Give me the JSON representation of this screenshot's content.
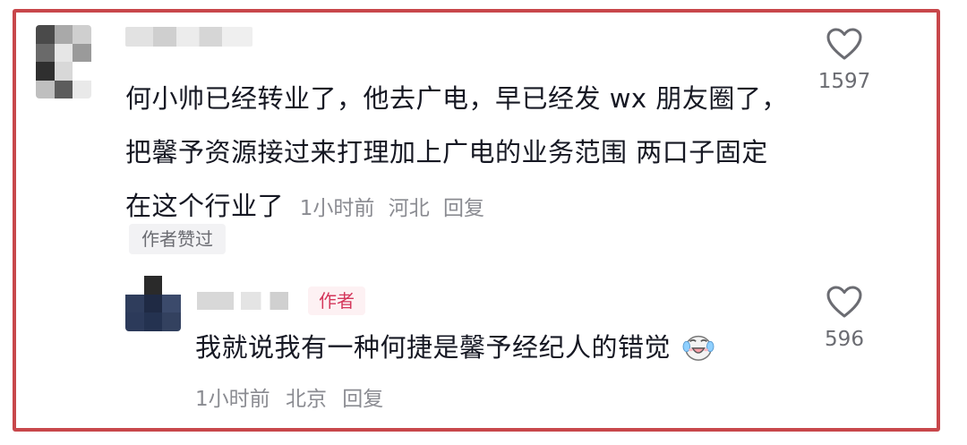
{
  "comment": {
    "avatar_colors": [
      "#4a4a4a",
      "#a9a9a9",
      "#cfcfcf",
      "#6a6a6a",
      "#e6e6e6",
      "#9a9a9a",
      "#2f2f2f",
      "#d8d8d8",
      "#ffffff",
      "#bfbfbf",
      "#5c5c5c",
      "#e9e9e9"
    ],
    "text": "何小帅已经转业了，他去广电，早已经发 wx 朋友圈了，把馨予资源接过来打理加上广电的业务范围 两口子固定在这个行业了",
    "time": "1小时前",
    "location": "河北",
    "reply_label": "回复",
    "author_liked_label": "作者赞过",
    "like_count": "1597"
  },
  "reply": {
    "avatar_colors": [
      "#ffffff",
      "#2a2a2a",
      "#ffffff",
      "#2f3d5c",
      "#1f2a44",
      "#3b4a6b",
      "#2c3a5a",
      "#243250",
      "#33415f"
    ],
    "author_badge": "作者",
    "text": "我就说我有一种何捷是馨予经纪人的错觉",
    "emoji_name": "crying-laughing-emoji",
    "time": "1小时前",
    "location": "北京",
    "reply_label": "回复",
    "like_count": "596"
  },
  "colors": {
    "frame_border": "#c8474b",
    "badge_text": "#d4365b",
    "badge_bg": "#fdf1f3",
    "meta_text": "#8a8b91"
  }
}
